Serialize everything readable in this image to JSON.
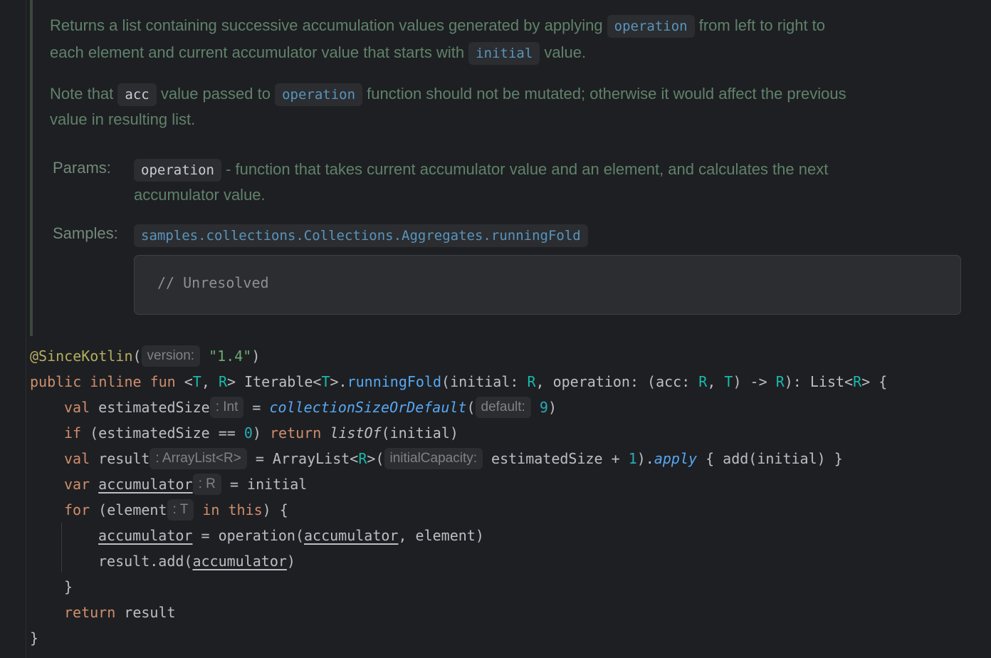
{
  "doc": {
    "p1_line1_pre": "Returns a list containing successive accumulation values generated by applying ",
    "p1_chip1": "operation",
    "p1_line1_post": " from left to right to",
    "p1_line2_pre": "each element and current accumulator value that starts with ",
    "p1_chip2": "initial",
    "p1_line2_post": " value.",
    "p2_pre": "Note that ",
    "p2_chip1": "acc",
    "p2_mid": " value passed to ",
    "p2_chip2": "operation",
    "p2_post": " function should not be mutated; otherwise it would affect the previous",
    "p2_line2": "value in resulting list.",
    "params_label": "Params:",
    "params_chip": "operation",
    "params_line1": " - function that takes current accumulator value and an element, and calculates the next",
    "params_line2": "accumulator value.",
    "samples_label": "Samples:",
    "samples_link": "samples.collections.Collections.Aggregates.runningFold",
    "sample_code": "// Unresolved"
  },
  "code": {
    "annotation": "@SinceKotlin",
    "version_hint": "version:",
    "version_value": "\"1.4\"",
    "estimated_type_hint": ": Int",
    "default_hint": "default:",
    "default_value": "9",
    "result_type_hint": ": ArrayList<R>",
    "capacity_hint": "initialCapacity:",
    "accumulator_type_hint": ": R",
    "element_type_hint": ": T",
    "zero": "0",
    "one": "1"
  },
  "colors": {
    "background": "#1e1f22",
    "doc_text": "#5f826b",
    "keyword": "#cf8e6d",
    "function": "#56a8f5",
    "type_param": "#16baac",
    "string": "#6aab73",
    "annotation": "#b3ae60"
  }
}
